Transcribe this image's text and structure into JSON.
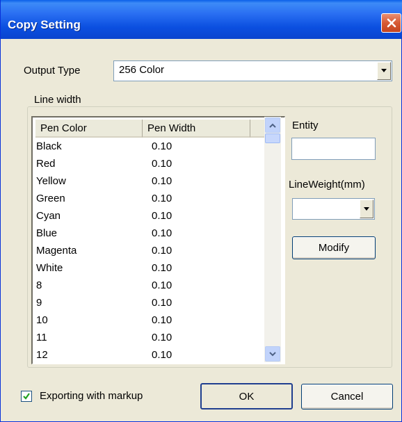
{
  "window": {
    "title": "Copy Setting",
    "close_label": "close"
  },
  "output_type": {
    "label": "Output Type",
    "value": "256 Color"
  },
  "line_width": {
    "group_label": "Line width",
    "columns": [
      "Pen Color",
      "Pen Width"
    ],
    "rows": [
      {
        "color": "Black",
        "width": "0.10"
      },
      {
        "color": "Red",
        "width": "0.10"
      },
      {
        "color": "Yellow",
        "width": "0.10"
      },
      {
        "color": "Green",
        "width": "0.10"
      },
      {
        "color": "Cyan",
        "width": "0.10"
      },
      {
        "color": "Blue",
        "width": "0.10"
      },
      {
        "color": "Magenta",
        "width": "0.10"
      },
      {
        "color": "White",
        "width": "0.10"
      },
      {
        "color": "8",
        "width": "0.10"
      },
      {
        "color": "9",
        "width": "0.10"
      },
      {
        "color": "10",
        "width": "0.10"
      },
      {
        "color": "11",
        "width": "0.10"
      },
      {
        "color": "12",
        "width": "0.10"
      }
    ]
  },
  "entity": {
    "label": "Entity",
    "value": ""
  },
  "line_weight": {
    "label": "LineWeight(mm)",
    "value": ""
  },
  "buttons": {
    "modify": "Modify",
    "ok": "OK",
    "cancel": "Cancel"
  },
  "export_markup": {
    "label": "Exporting with markup",
    "checked": true
  }
}
